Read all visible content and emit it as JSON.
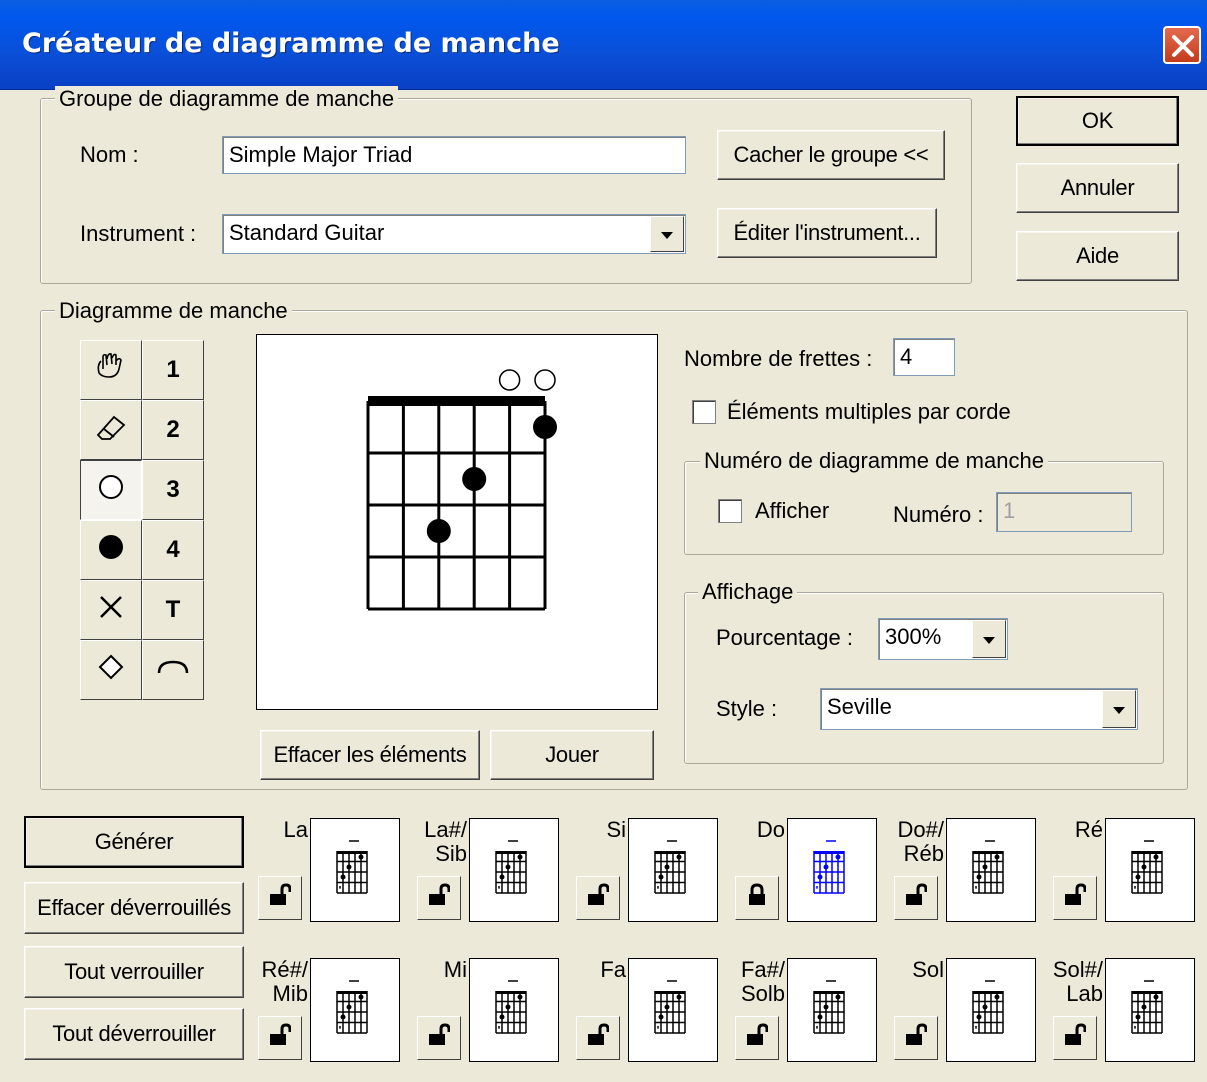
{
  "window": {
    "title": "Créateur de diagramme de manche"
  },
  "group": {
    "legend": "Groupe de diagramme de manche",
    "name_label": "Nom :",
    "name_value": "Simple Major Triad",
    "instrument_label": "Instrument :",
    "instrument_value": "Standard Guitar",
    "hide_group_label": "Cacher le groupe <<",
    "edit_instrument_label": "Éditer l'instrument..."
  },
  "dialog_buttons": {
    "ok": "OK",
    "cancel": "Annuler",
    "help": "Aide"
  },
  "diagram": {
    "legend": "Diagramme de manche",
    "tools_left": [
      "hand-icon",
      "eraser-icon",
      "open-circle-icon",
      "filled-dot-icon",
      "x-mark-icon",
      "diamond-icon"
    ],
    "tools_right": [
      "1",
      "2",
      "3",
      "4",
      "T",
      "⌒"
    ],
    "selected_tool": "open-circle-icon",
    "clear_label": "Effacer les éléments",
    "play_label": "Jouer",
    "fret_count_label": "Nombre de frettes :",
    "fret_count_value": "4",
    "multiple_label": "Éléments multiples par corde",
    "multiple_checked": false,
    "number_legend": "Numéro de diagramme de manche",
    "show_label": "Afficher",
    "show_checked": false,
    "number_label": "Numéro :",
    "number_value": "1",
    "display_legend": "Affichage",
    "percent_label": "Pourcentage :",
    "percent_value": "300%",
    "style_label": "Style :",
    "style_value": "Seville",
    "chord": {
      "strings": 6,
      "frets": 4,
      "open_strings": [
        4,
        5
      ],
      "dots": [
        {
          "string": 5,
          "fret": 1
        },
        {
          "string": 3,
          "fret": 2
        },
        {
          "string": 2,
          "fret": 3
        }
      ]
    }
  },
  "actions": {
    "generate": "Générer",
    "clear_unlocked": "Effacer déverrouillés",
    "lock_all": "Tout verrouiller",
    "unlock_all": "Tout déverrouiller"
  },
  "chords": [
    {
      "line1": "La",
      "line2": "",
      "locked": false
    },
    {
      "line1": "La#/",
      "line2": "Sib",
      "locked": false
    },
    {
      "line1": "Si",
      "line2": "",
      "locked": false
    },
    {
      "line1": "Do",
      "line2": "",
      "locked": true
    },
    {
      "line1": "Do#/",
      "line2": "Réb",
      "locked": false
    },
    {
      "line1": "Ré",
      "line2": "",
      "locked": false
    },
    {
      "line1": "Ré#/",
      "line2": "Mib",
      "locked": false
    },
    {
      "line1": "Mi",
      "line2": "",
      "locked": false
    },
    {
      "line1": "Fa",
      "line2": "",
      "locked": false
    },
    {
      "line1": "Fa#/",
      "line2": "Solb",
      "locked": false
    },
    {
      "line1": "Sol",
      "line2": "",
      "locked": false
    },
    {
      "line1": "Sol#/",
      "line2": "Lab",
      "locked": false
    }
  ],
  "colors": {
    "titlebar": "#0a4fd8",
    "selected_chord": "#0000ff",
    "face": "#ece9d8"
  }
}
